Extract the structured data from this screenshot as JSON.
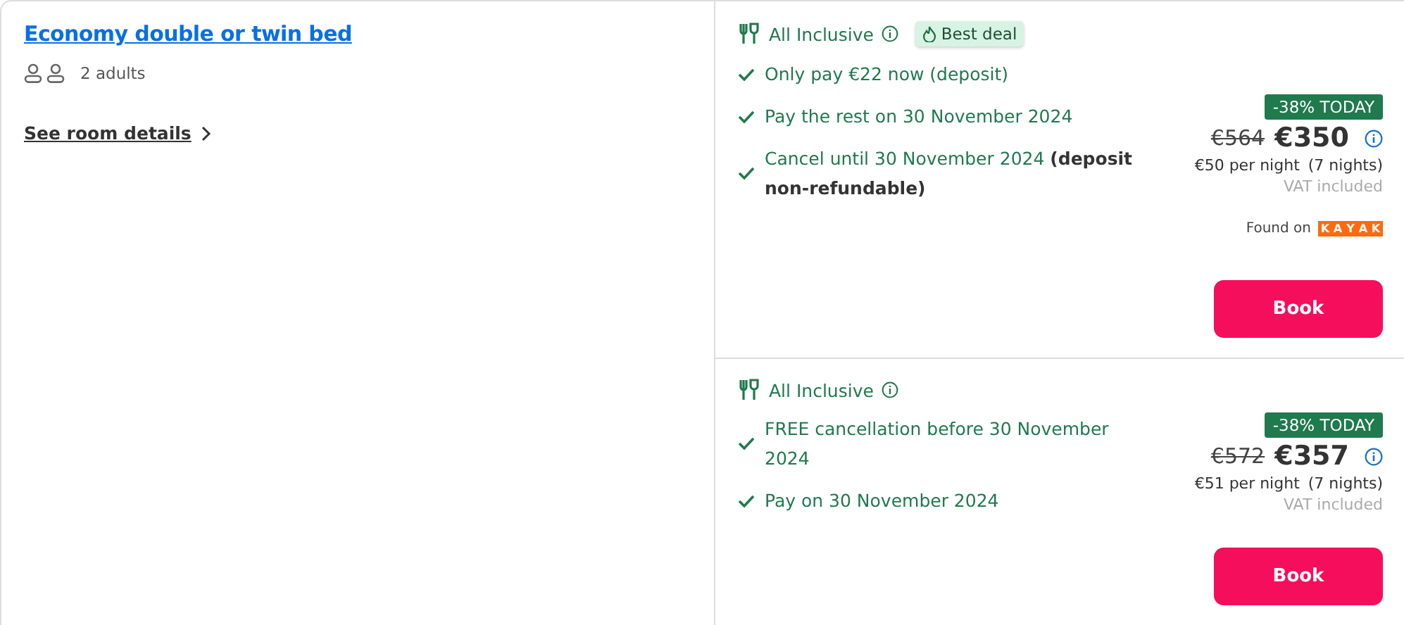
{
  "room": {
    "title": "Economy double or twin bed",
    "occupancy": "2 adults",
    "details_link": "See room details"
  },
  "offers": [
    {
      "board": "All Inclusive",
      "best_deal": "Best deal",
      "features": [
        "Only pay €22 now (deposit)",
        "Pay the rest on 30 November 2024",
        "Cancel until 30 November 2024 **(deposit non-refundable)**"
      ],
      "discount": "-38% TODAY",
      "old_price": "€564",
      "price": "€350",
      "per_night": "€50 per night",
      "nights": "(7 nights)",
      "vat": "VAT included",
      "found_on": {
        "label": "Found on",
        "logo_letters": [
          "K",
          "A",
          "Y",
          "A",
          "K"
        ]
      },
      "button": "Book"
    },
    {
      "board": "All Inclusive",
      "features": [
        "FREE cancellation before 30 November 2024",
        "Pay on 30 November 2024"
      ],
      "discount": "-38% TODAY",
      "old_price": "€572",
      "price": "€357",
      "per_night": "€51 per night",
      "nights": "(7 nights)",
      "vat": "VAT included",
      "button": "Book"
    }
  ]
}
